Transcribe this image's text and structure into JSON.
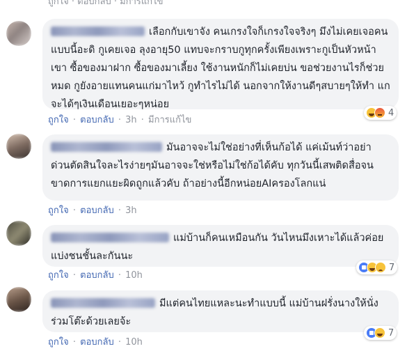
{
  "header_actions": {
    "like": "ถูกใจ",
    "reply": "ตอบกลับ",
    "edited": "มีการแก้ไข"
  },
  "comments": [
    {
      "text": "เลือกกับเขาจัง คนเกรงใจก็เกรงใจจริงๆ มึงไม่เคยเจอคนแบบนี้อะดิ กูเคยเจอ ลุงอายุ50 แทบจะกราบกูทุกครั้งเพียงเพราะกูเป็นหัวหน้าเขา ซื้อของมาฝาก ซื้อของมาเลี้ยง ใช้งานหนักก็ไม่เคยบ่น ขอช่วยงานไรก็ช่วยหมด กูยังอายแทนคนแก่มาไหว้ กูทำไรไม่ได้ นอกจากให้งานดีๆสบายๆให้ทำ แกจะได้ๆเงินเดือนเยอะๆหน่อย",
      "like": "ถูกใจ",
      "reply": "ตอบกลับ",
      "time": "3h",
      "edited": "มีการแก้ไข",
      "reaction_icons": [
        "haha-icon",
        "angry-icon"
      ],
      "reaction_count": "4"
    },
    {
      "text": "มันอาจจะไม่ใช่อย่างที่เห็นก้อได้ แค่เม้นท์ว่าอย่าด่วนตัดสินใจละไรง่ายๆมันอาจจะใช่หรือไม่ใช่ก้อได้คับ ทุกวันนี้เสพติดสื่อจนขาดการแยกแยะผิดถูกแล้วคับ ถ้าอย่างนี้อีกหน่อยAIครองโลกแน่",
      "like": "ถูกใจ",
      "reply": "ตอบกลับ",
      "time": "3h"
    },
    {
      "text": "แม่บ้านก็คนเหมือนกัน วันไหนมึงเหาะได้แล้วค่อยแบ่งชนชั้นละกันนะ",
      "like": "ถูกใจ",
      "reply": "ตอบกลับ",
      "time": "10h",
      "reaction_icons": [
        "like-icon",
        "haha-icon",
        "sad-icon"
      ],
      "reaction_count": "7"
    },
    {
      "text": "มีแต่คนไทยแหละนะทำแบบนี้ แม่บ้านฝรั่งนางให้นั่งร่วมโต๊ะด้วยเลยจ้ะ",
      "like": "ถูกใจ",
      "reply": "ตอบกลับ",
      "time": "10h",
      "reaction_icons": [
        "like-icon",
        "haha-icon"
      ],
      "reaction_count": "7"
    }
  ],
  "colors": {
    "bubble": "#f2f3f5",
    "link": "#4267b2",
    "meta": "#90949c",
    "text": "#1d2129"
  }
}
